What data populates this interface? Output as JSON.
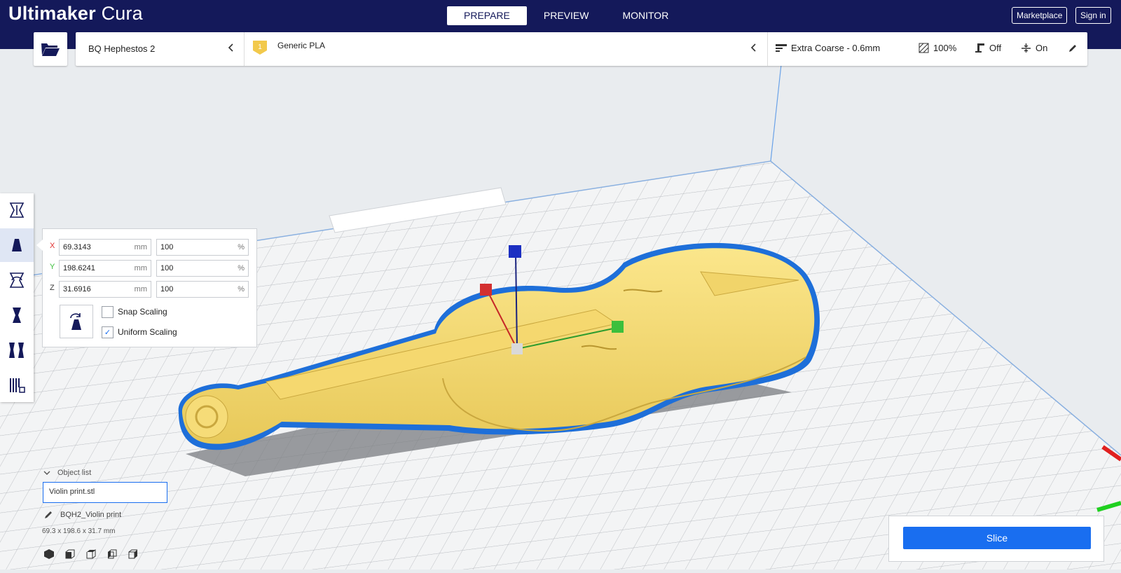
{
  "app": {
    "logo_bold": "Ultimaker",
    "logo_light": "Cura"
  },
  "stages": [
    {
      "label": "PREPARE",
      "active": true
    },
    {
      "label": "PREVIEW",
      "active": false
    },
    {
      "label": "MONITOR",
      "active": false
    }
  ],
  "header_buttons": {
    "marketplace": "Marketplace",
    "sign_in": "Sign in"
  },
  "printer": {
    "name": "BQ Hephestos 2"
  },
  "material": {
    "extruder": "1",
    "name": "Generic PLA"
  },
  "print_settings": {
    "profile": "Extra Coarse - 0.6mm",
    "infill": "100%",
    "support": "Off",
    "adhesion": "On"
  },
  "scale_tool": {
    "rows": [
      {
        "axis": "X",
        "mm": "69.3143",
        "percent": "100",
        "color": "#e03030"
      },
      {
        "axis": "Y",
        "mm": "198.6241",
        "percent": "100",
        "color": "#3cbf3c"
      },
      {
        "axis": "Z",
        "mm": "31.6916",
        "percent": "100",
        "color": "#3a3a3a"
      }
    ],
    "mm_unit": "mm",
    "pct_unit": "%",
    "snap_scaling": {
      "label": "Snap Scaling",
      "checked": false
    },
    "uniform_scaling": {
      "label": "Uniform Scaling",
      "checked": true
    }
  },
  "object_list": {
    "header": "Object list",
    "selected": "Violin  print.stl"
  },
  "job": {
    "name": "BQH2_Violin  print",
    "dimensions": "69.3 x 198.6 x 31.7 mm"
  },
  "slice": {
    "label": "Slice"
  },
  "colors": {
    "header_bg": "#14195a",
    "accent": "#196ef0",
    "model": "#f7df78",
    "outline": "#1e6fd9"
  }
}
